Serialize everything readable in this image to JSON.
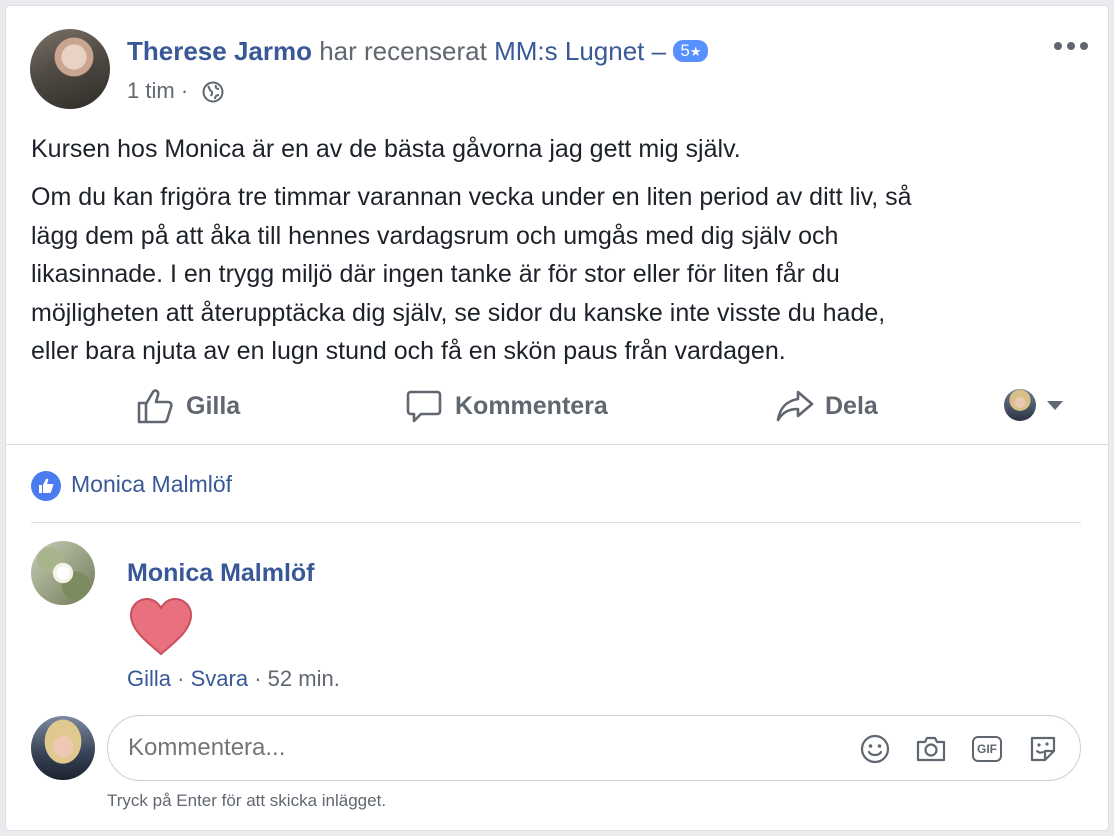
{
  "post": {
    "author": "Therese Jarmo",
    "verb": "har recenserat",
    "page": "MM:s Lugnet",
    "dash": "–",
    "rating": "5",
    "time": "1 tim",
    "separator": "·",
    "paragraph1": "Kursen hos Monica är en av de bästa gåvorna jag gett mig själv.",
    "paragraph2_lines": [
      "Om du kan frigöra tre timmar varannan vecka under en liten period av ditt liv, så",
      "lägg dem på att åka till hennes vardagsrum och umgås med dig själv och",
      "likasinnade. I en trygg miljö där ingen tanke är för stor eller för liten får du",
      "möjligheten att återupptäcka dig själv, se sidor du kanske inte visste du hade,",
      "eller bara njuta av en lugn stund och få en skön paus från vardagen."
    ]
  },
  "actions": {
    "like": "Gilla",
    "comment": "Kommentera",
    "share": "Dela"
  },
  "likes": {
    "name": "Monica Malmlöf"
  },
  "comment": {
    "author": "Monica Malmlöf",
    "like": "Gilla",
    "reply": "Svara",
    "time": "52 min.",
    "dot": "·"
  },
  "composer": {
    "placeholder": "Kommentera...",
    "hint": "Tryck på Enter för att skicka inlägget."
  },
  "colors": {
    "link": "#385898",
    "accent": "#4267b2",
    "heart": "#e9707f"
  }
}
